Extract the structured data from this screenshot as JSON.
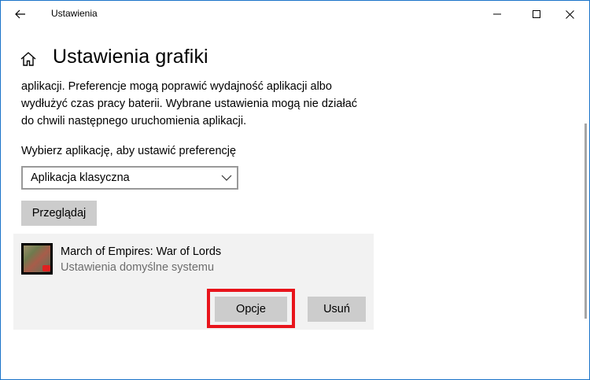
{
  "window": {
    "title": "Ustawienia",
    "border_color": "#1a73c9"
  },
  "icons": {
    "back": "arrow-left-icon",
    "minimize": "minimize-icon",
    "maximize": "maximize-icon",
    "close": "close-icon",
    "home": "home-icon",
    "dropdown": "chevron-down-icon"
  },
  "page": {
    "title": "Ustawienia grafiki",
    "description_lines": [
      "aplikacji. Preferencje mogą poprawić wydajność aplikacji albo",
      "wydłużyć czas pracy baterii. Wybrane ustawienia mogą nie działać",
      "do chwili następnego uruchomienia aplikacji."
    ],
    "choose_label": "Wybierz aplikację, aby ustawić preferencję"
  },
  "app_type_select": {
    "selected": "Aplikacja klasyczna"
  },
  "browse_button": "Przeglądaj",
  "app_card": {
    "name": "March of Empires: War of Lords",
    "setting": "Ustawienia domyślne systemu",
    "options_button": "Opcje",
    "remove_button": "Usuń",
    "highlight_color": "#e8141b"
  }
}
